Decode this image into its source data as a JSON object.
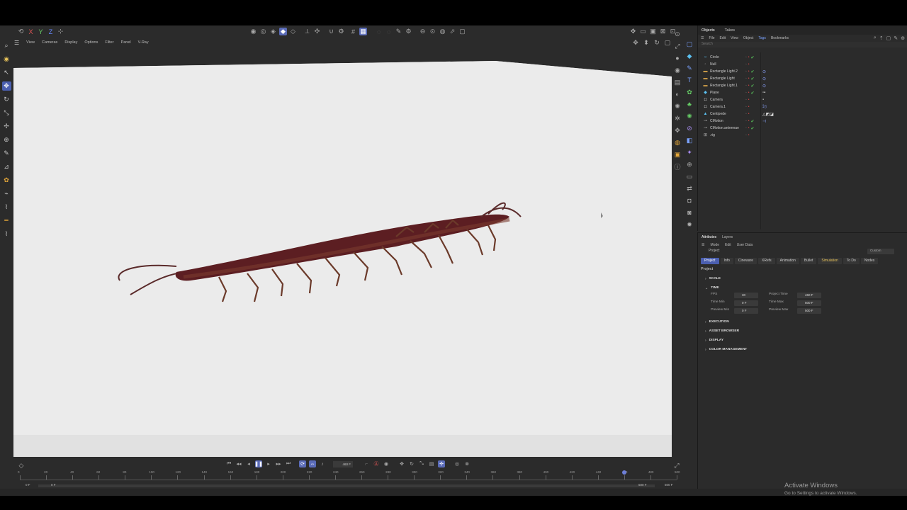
{
  "viewport_menu": [
    "View",
    "Cameras",
    "Display",
    "Options",
    "Filter",
    "Panel",
    "V-Ray"
  ],
  "top_axis_buttons": [
    "X",
    "Y",
    "Z"
  ],
  "objects_panel": {
    "tabs": [
      "Objects",
      "Takes"
    ],
    "active_tab": "Objects",
    "menu": [
      "File",
      "Edit",
      "View",
      "Object",
      "Tags",
      "Bookmarks"
    ],
    "search_placeholder": "Search",
    "objects": [
      {
        "name": "Circle",
        "icon": "circle-icon"
      },
      {
        "name": "Null",
        "icon": "null-icon"
      },
      {
        "name": "Rectangle Light.2",
        "icon": "light-icon"
      },
      {
        "name": "Rectangle Light",
        "icon": "light-icon"
      },
      {
        "name": "Rectangle Light.1",
        "icon": "light-icon"
      },
      {
        "name": "Plane",
        "icon": "plane-icon"
      },
      {
        "name": "Camera",
        "icon": "camera-icon"
      },
      {
        "name": "Camera.1",
        "icon": "camera-icon"
      },
      {
        "name": "Centipede",
        "icon": "mesh-icon"
      },
      {
        "name": "CMotion",
        "icon": "cmotion-icon"
      },
      {
        "name": "CMotion.antennae",
        "icon": "cmotion-icon"
      },
      {
        "name": ".rig",
        "icon": "null-icon"
      }
    ]
  },
  "attributes_panel": {
    "tabs": [
      "Attributes",
      "Layers"
    ],
    "menu": [
      "Mode",
      "Edit",
      "User Data"
    ],
    "breadcrumb": "Project",
    "mode_select": "Custom",
    "project_tabs": [
      "Project",
      "Info",
      "Cineware",
      "XRefs",
      "Animation",
      "Bullet",
      "Simulation",
      "To Do",
      "Nodes"
    ],
    "active_project_tab": "Project",
    "title": "Project",
    "sections": {
      "scale": "SCALE",
      "time": "TIME",
      "execution": "EXECUTION",
      "asset_browser": "ASSET BROWSER",
      "display": "DISPLAY",
      "color_management": "COLOR MANAGEMENT"
    },
    "fields": {
      "fps_label": "FPS",
      "fps_value": "30",
      "project_time_label": "Project Time",
      "project_time_value": "460 F",
      "time_min_label": "Time Min",
      "time_min_value": "0 F",
      "time_max_label": "Time Max",
      "time_max_value": "500 F",
      "preview_min_label": "Preview Min",
      "preview_min_value": "0 F",
      "preview_max_label": "Preview Max",
      "preview_max_value": "500 F"
    }
  },
  "timeline": {
    "current_frame": "460 F",
    "ruler_ticks": [
      "0",
      "20",
      "40",
      "60",
      "80",
      "100",
      "120",
      "140",
      "160",
      "180",
      "200",
      "220",
      "240",
      "260",
      "280",
      "300",
      "320",
      "340",
      "360",
      "380",
      "400",
      "420",
      "440",
      "460",
      "480",
      "500"
    ],
    "range_start": "0 F",
    "range_start2": "0 F",
    "range_end": "500 F",
    "range_end2": "500 F",
    "playhead_frame": 460,
    "max_frame": 500
  },
  "watermark": {
    "title": "Activate Windows",
    "subtitle": "Go to Settings to activate Windows."
  }
}
